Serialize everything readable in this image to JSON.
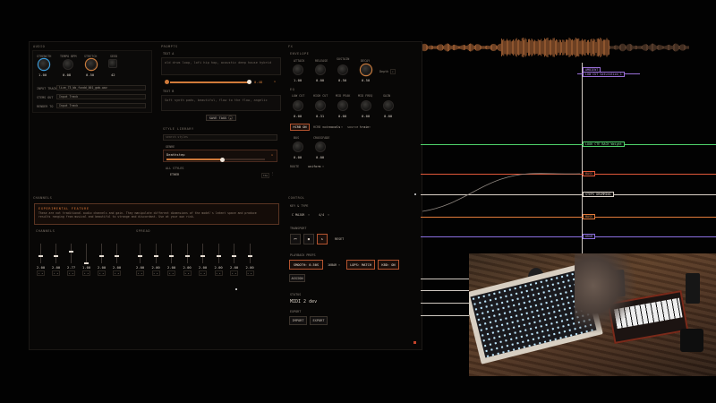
{
  "top_right_label": "",
  "audio_panel": {
    "title": "AUDIO",
    "knobs": [
      {
        "label": "STRENGTH",
        "value": "1.00"
      },
      {
        "label": "TEMPO BPM",
        "value": "0.08"
      },
      {
        "label": "STRETCH",
        "value": "0.50"
      },
      {
        "label": "SEED",
        "value": "42"
      }
    ],
    "file_rows": [
      {
        "label": "INPUT TRACK",
        "value": "live_73_bb_fundd_001_gab.wav"
      },
      {
        "label": "STEMS OUT",
        "value": "Input Track"
      },
      {
        "label": "RENDER TO",
        "value": "Input Track"
      }
    ]
  },
  "prompt_panel": {
    "title": "PROMPTS",
    "prompt_a_label": "TEXT A",
    "prompt_a_text": "old drum loop, lofi hip hop, acoustic deep house hybrid",
    "prompt_b_label": "TEXT B",
    "prompt_b_text": "Soft synth pads, beautiful, flow to the flow, angelic",
    "slider_value": "0.48",
    "save_label": "SAVE TAGS",
    "library_title": "STYLE LIBRARY",
    "search_placeholder": "search styles",
    "style_group_label": "GENRE",
    "selected_style": "Deathstep",
    "list_label": "ALL STYLES",
    "list_item": "ETHER",
    "list_badge": "TAG"
  },
  "fx_panel": {
    "title": "FX",
    "group1_label": "ENVELOPE",
    "group1_knobs": [
      {
        "label": "ATTACK",
        "value": "1.00"
      },
      {
        "label": "RELEASE",
        "value": "0.00"
      },
      {
        "label": "SUSTAIN",
        "value": "0.50"
      },
      {
        "label": "DECAY",
        "value": "0.50"
      }
    ],
    "group1_select": "Depth",
    "group2_label": "EQ",
    "group2_knobs": [
      {
        "label": "LOW CUT",
        "value": "0.00"
      },
      {
        "label": "HIGH CUT",
        "value": "0.31"
      },
      {
        "label": "MID PEAK",
        "value": "0.00"
      },
      {
        "label": "MID FREQ",
        "value": "0.00"
      },
      {
        "label": "GAIN",
        "value": "0.00"
      }
    ],
    "toggle_label": "HCRB ON",
    "mode_label": "HCRB mode",
    "mode_value": "vocals",
    "source_label": "source",
    "source_value": "train",
    "group3_knobs": [
      {
        "label": "BUS",
        "value": "0.00"
      },
      {
        "label": "CROSSFADE",
        "value": "0.00"
      }
    ],
    "route_label": "ROUTE",
    "route_value": "uniform"
  },
  "channels_panel": {
    "title": "CHANNELS",
    "warning_title": "EXPERIMENTAL FEATURE",
    "warning_text": "These are not traditional audio channels and gain. They manipulate different dimensions of the model's latent space and produce results ranging from musical and beautiful to strange and discordant. Use at your own risk.",
    "group_a_label": "CHANNELS",
    "group_a_values": [
      "2.00",
      "2.00",
      "2.77",
      "1.00",
      "2.00",
      "2.00"
    ],
    "group_b_label": "SPREAD",
    "group_b_values": [
      "2.00",
      "2.00",
      "2.00",
      "2.00",
      "2.00",
      "2.00",
      "2.00",
      "2.00"
    ]
  },
  "control_panel": {
    "title": "CONTROL",
    "key_label": "KEY & TYPE",
    "key_value": "C MAJOR",
    "type_value": "4/4",
    "transport_label": "TRANSPORT",
    "transport_buttons": [
      "⏮",
      "■",
      "↻"
    ],
    "reset_label": "RESET",
    "playback_label": "PLAYBACK PREFS",
    "smooth_label": "SMOOTH: 0.50S",
    "length_value": "16BAR",
    "loops_label": "LOPS: MATCH",
    "kbd_label": "KBD: ON",
    "assign_label": "ASSIGN",
    "device_label": "STATUS",
    "device_value": "MIDI 2 dev",
    "export_label": "EXPORT",
    "export_buttons": [
      "IMPORT",
      "EXPORT"
    ]
  },
  "timeline": {
    "tags": [
      {
        "text": "AMBIENT",
        "color": "#9a6fd8"
      },
      {
        "text": "LOW CUT Saturation_1",
        "color": "#9a6fd8"
      },
      {
        "text": "LOOK CTE BACK Weight",
        "color": "#4fd16a"
      },
      {
        "text": "BASS",
        "color": "#e0583a"
      },
      {
        "text": "STEPS DRUMMING",
        "color": "#d8d0c6"
      },
      {
        "text": "BASS",
        "color": "#e07a3a"
      },
      {
        "text": "DRUM",
        "color": "#8a6fe0"
      }
    ]
  },
  "colors": {
    "accent": "#d07a3a",
    "danger": "#b4542f",
    "lane_green": "#4fd16a",
    "lane_red": "#e0583a",
    "lane_purple": "#9a6fd8"
  }
}
